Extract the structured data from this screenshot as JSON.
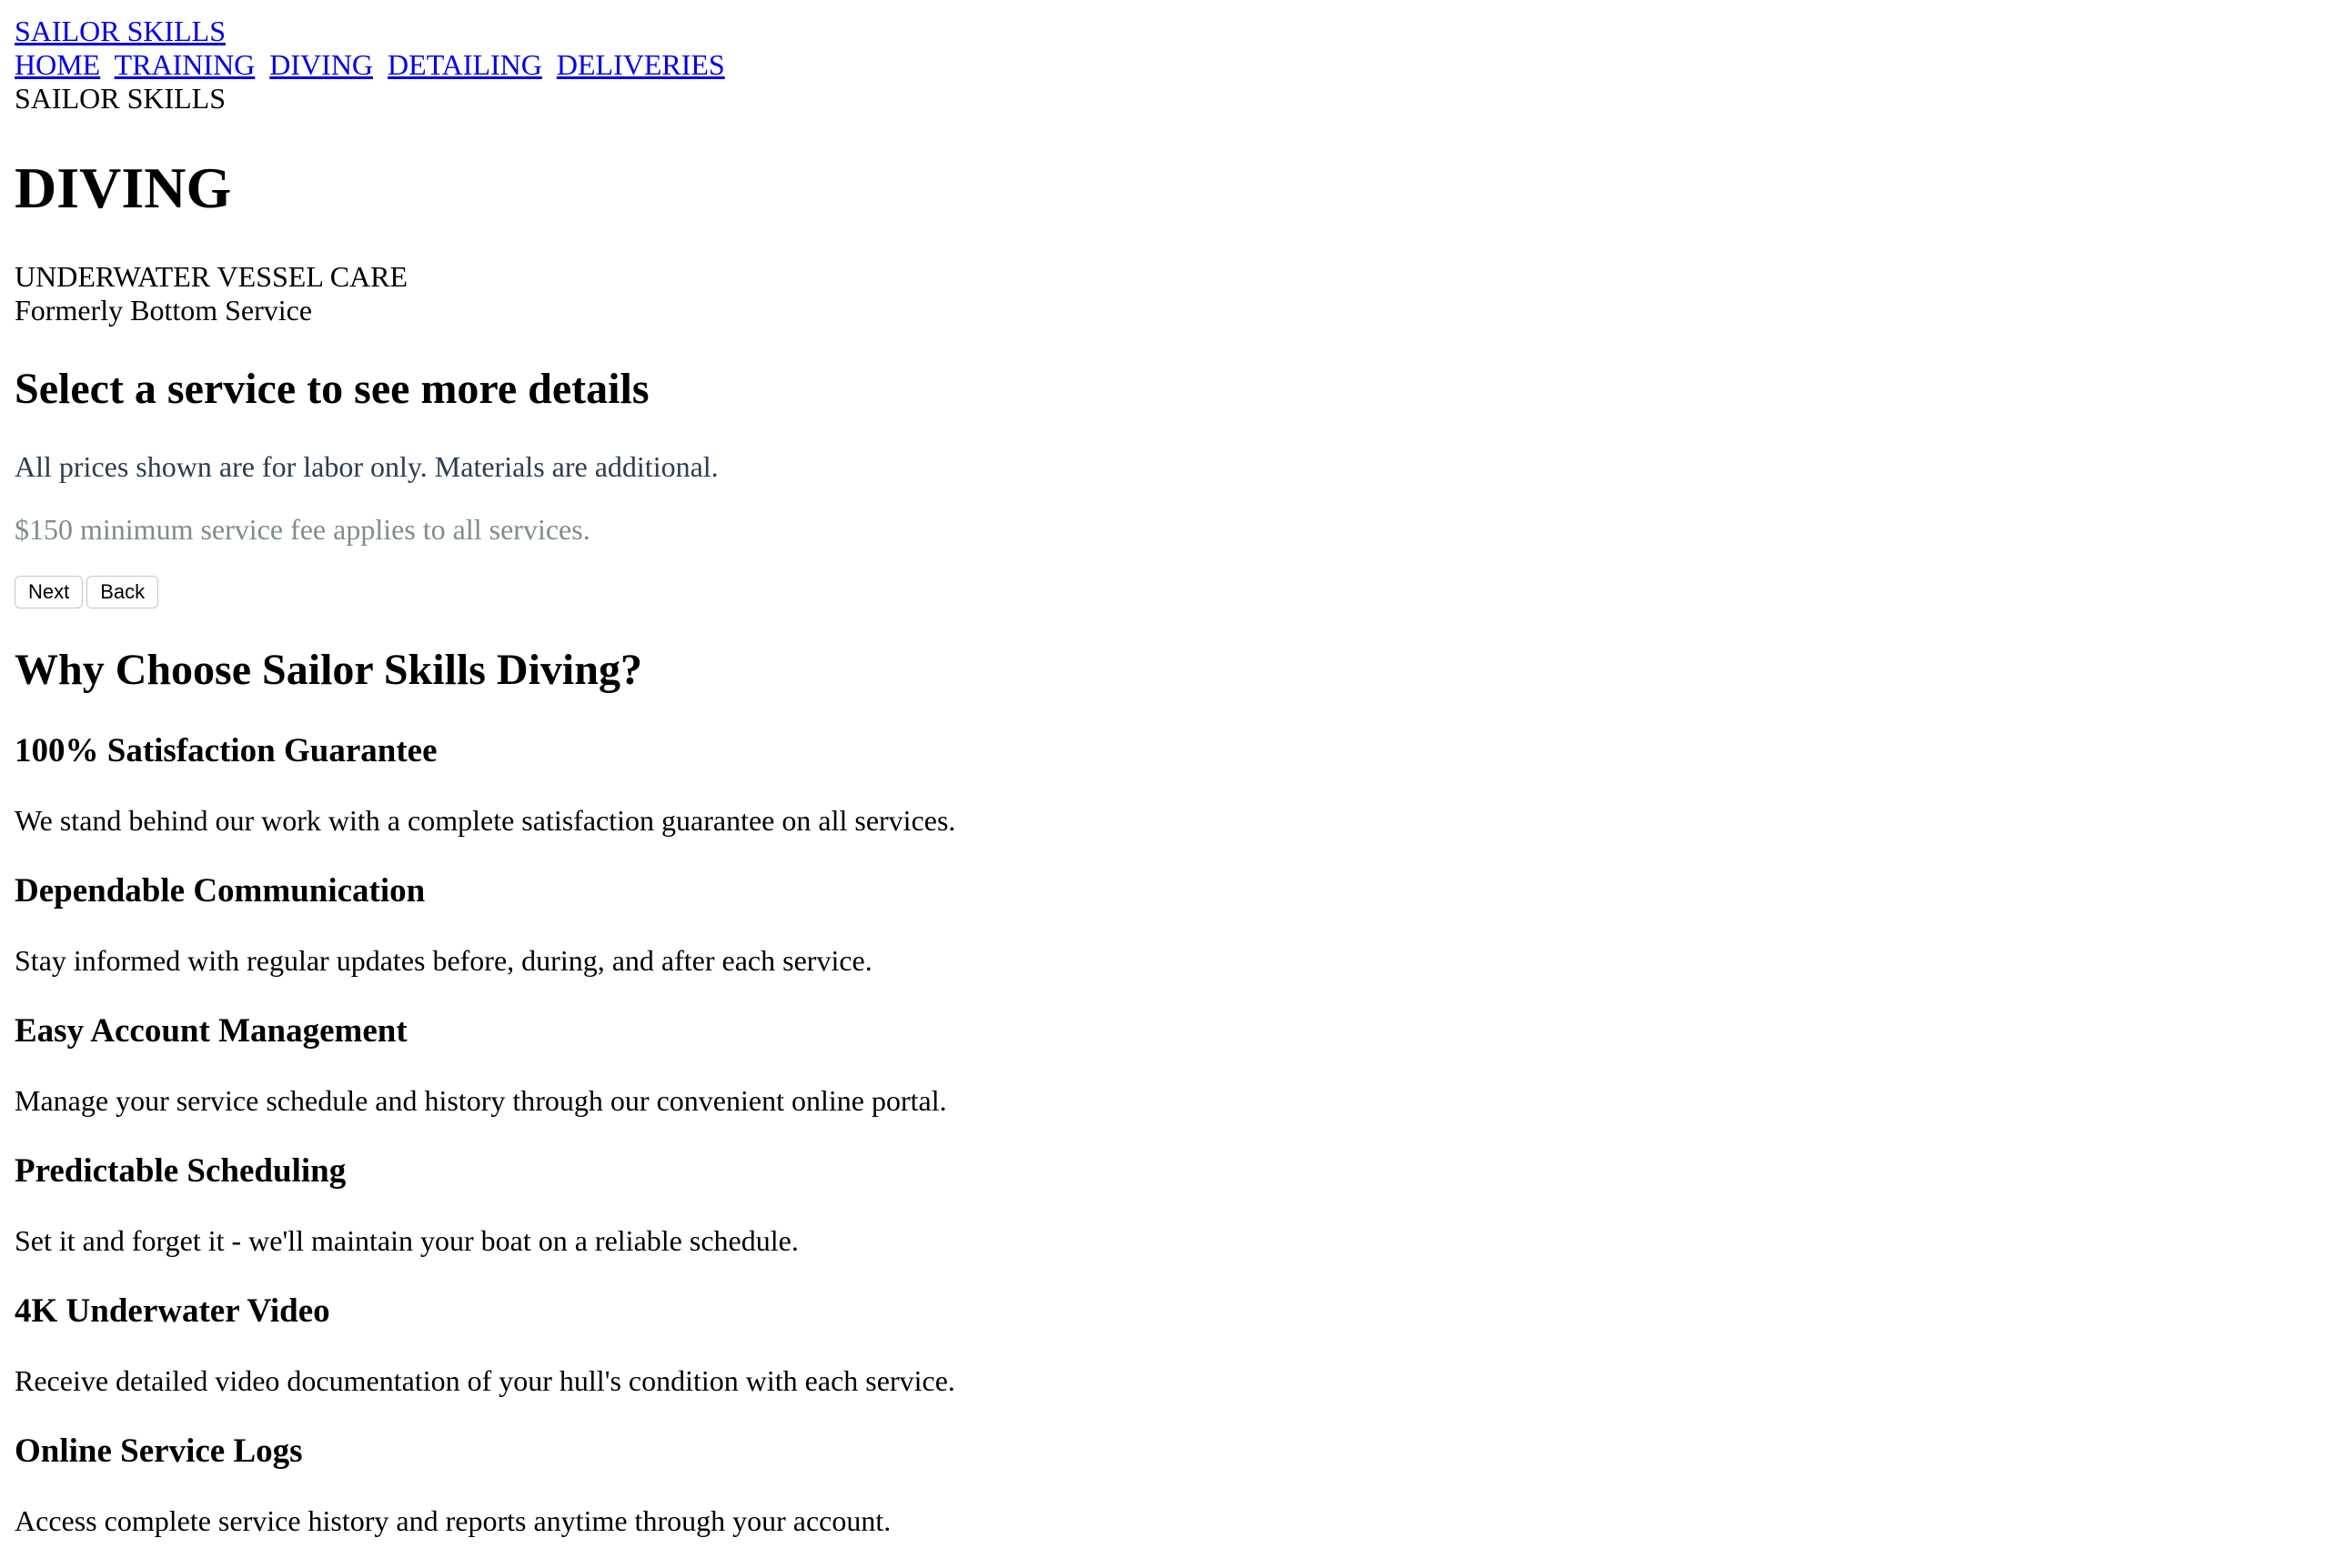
{
  "header": {
    "brand_link": "SAILOR SKILLS",
    "nav": [
      "HOME",
      "TRAINING",
      "DIVING",
      "DETAILING",
      "DELIVERIES"
    ],
    "brand_text": "SAILOR SKILLS"
  },
  "hero": {
    "title": "DIVING",
    "subtitle": "UNDERWATER VESSEL CARE",
    "formerly": "Formerly Bottom Service"
  },
  "services": {
    "heading": "Select a service to see more details",
    "labor_note": "All prices shown are for labor only. Materials are additional.",
    "minimum_note": "$150 minimum service fee applies to all services.",
    "next_label": "Next",
    "back_label": "Back"
  },
  "why": {
    "heading": "Why Choose Sailor Skills Diving?",
    "features": [
      {
        "title": "100% Satisfaction Guarantee",
        "text": "We stand behind our work with a complete satisfaction guarantee on all services."
      },
      {
        "title": "Dependable Communication",
        "text": "Stay informed with regular updates before, during, and after each service."
      },
      {
        "title": "Easy Account Management",
        "text": "Manage your service schedule and history through our convenient online portal."
      },
      {
        "title": "Predictable Scheduling",
        "text": "Set it and forget it - we'll maintain your boat on a reliable schedule."
      },
      {
        "title": "4K Underwater Video",
        "text": "Receive detailed video documentation of your hull's condition with each service."
      },
      {
        "title": "Online Service Logs",
        "text": "Access complete service history and reports anytime through your account."
      }
    ]
  },
  "colors": {
    "link": "#0000ee",
    "labor_note": "#2c3e50",
    "minimum_note": "#7f8c8d"
  }
}
